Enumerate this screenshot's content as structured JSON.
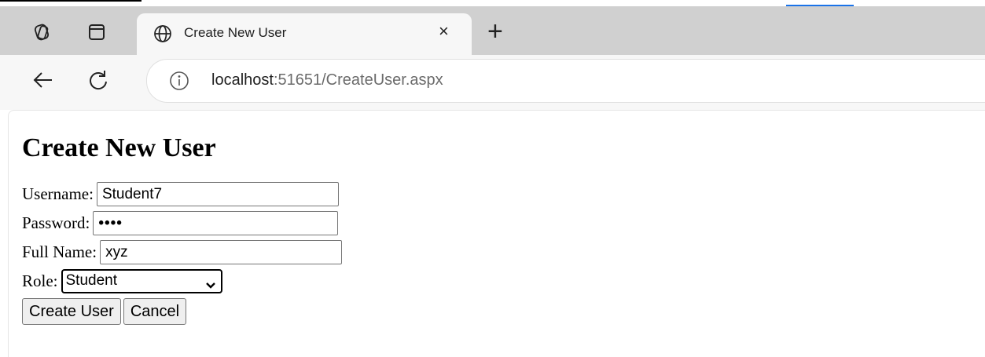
{
  "browser": {
    "tab_title": "Create New User",
    "tab_close": "×",
    "new_tab": "+",
    "url_host": "localhost",
    "url_path": ":51651/CreateUser.aspx"
  },
  "form": {
    "heading": "Create New User",
    "username_label": "Username:",
    "username_value": "Student7",
    "password_label": "Password:",
    "password_value": "••••",
    "fullname_label": "Full Name:",
    "fullname_value": "xyz",
    "role_label": "Role:",
    "role_value": "Student",
    "create_button": "Create User",
    "cancel_button": "Cancel"
  },
  "icons": {
    "workspaces": "workspaces-icon",
    "tab_actions": "tab-actions-icon",
    "globe": "globe-icon",
    "back": "back-arrow-icon",
    "refresh": "refresh-icon",
    "info": "info-icon",
    "dropdown": "chevron-down-icon"
  },
  "colors": {
    "tabstrip": "#d0d0d0",
    "active_tab": "#f7f7f7",
    "accent": "#1a73e8"
  }
}
